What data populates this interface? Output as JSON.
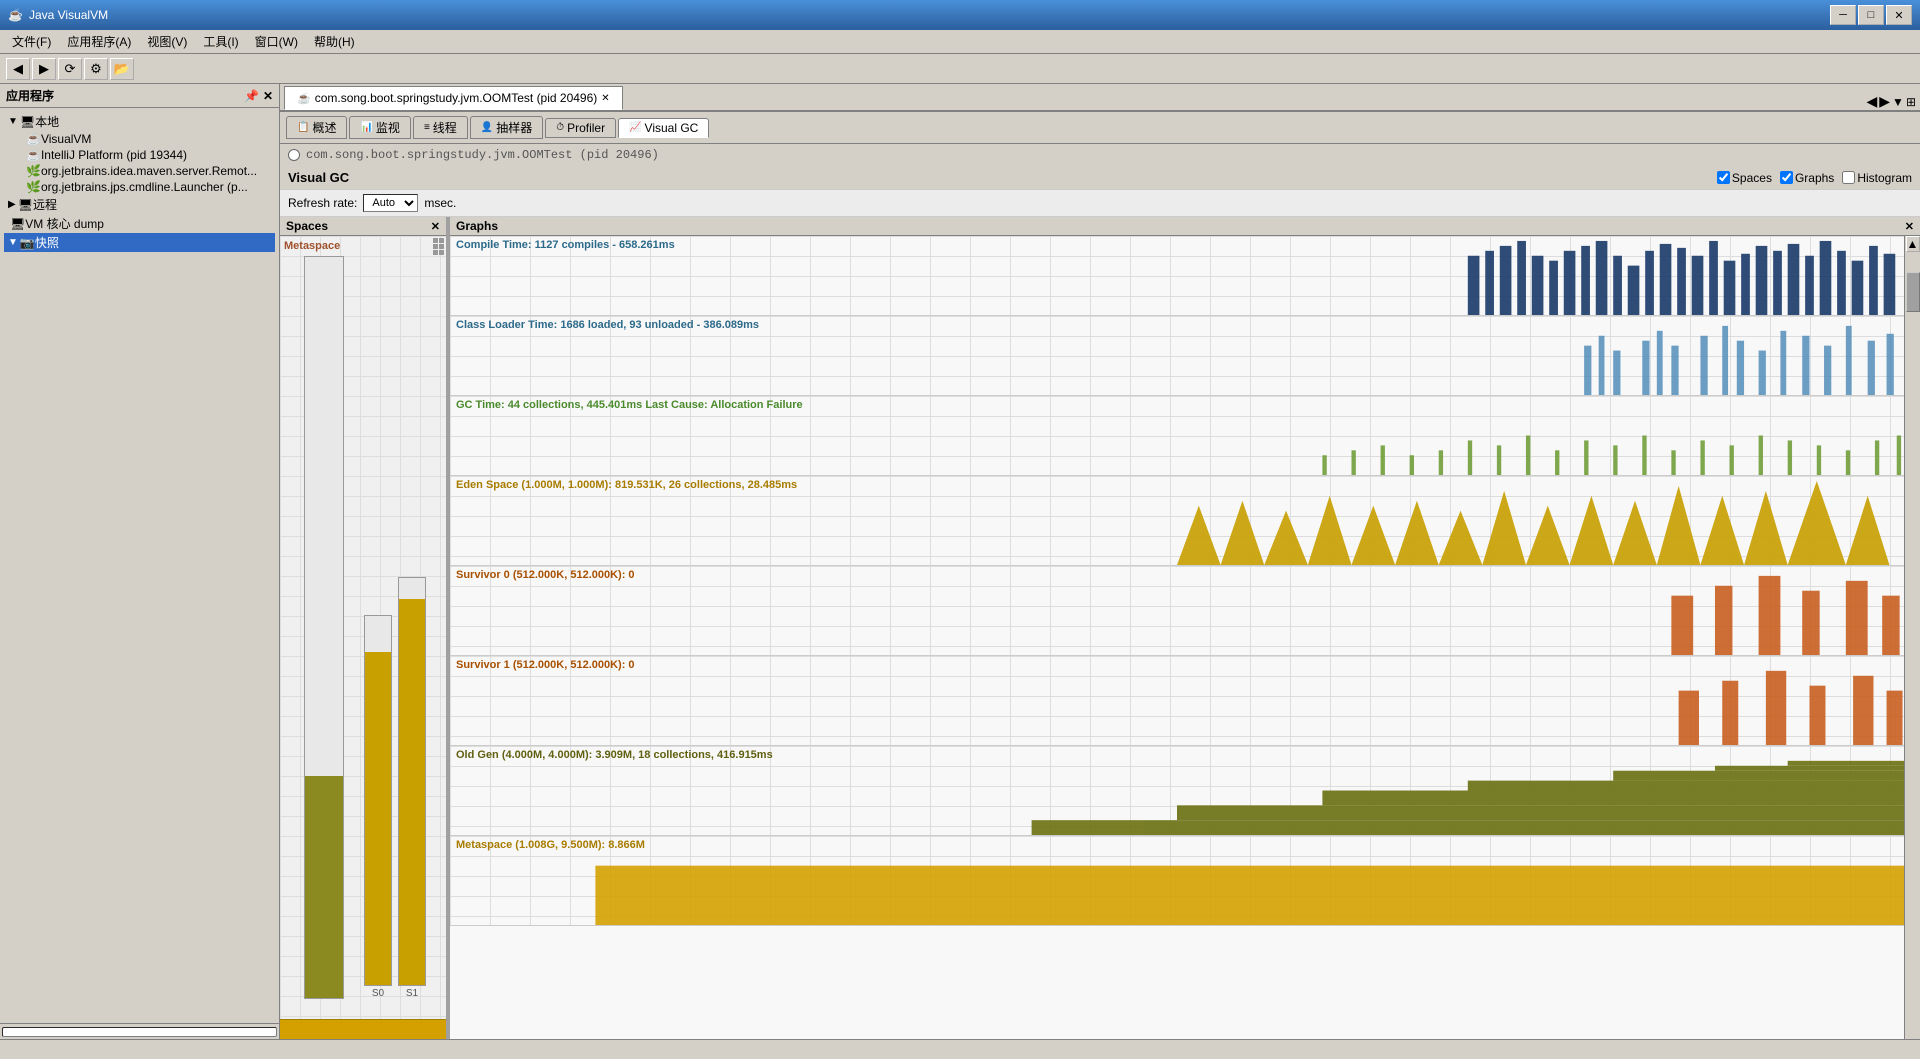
{
  "titleBar": {
    "title": "Java VisualVM",
    "icon": "☕",
    "controls": {
      "minimize": "─",
      "maximize": "□",
      "close": "✕"
    }
  },
  "menuBar": {
    "items": [
      "文件(F)",
      "应用程序(A)",
      "视图(V)",
      "工具(I)",
      "窗口(W)",
      "帮助(H)"
    ]
  },
  "toolbar": {
    "buttons": [
      "◀",
      "▶",
      "⟳",
      "⚙",
      "📂"
    ]
  },
  "sidebar": {
    "header": "应用程序",
    "closeBtn": "✕",
    "tree": [
      {
        "label": "本地",
        "level": 0,
        "icon": "🖥",
        "expanded": true
      },
      {
        "label": "VisualVM",
        "level": 1,
        "icon": "☕"
      },
      {
        "label": "IntelliJ Platform (pid 19344)",
        "level": 1,
        "icon": "☕"
      },
      {
        "label": "org.jetbrains.idea.maven.server.Remot...",
        "level": 1,
        "icon": "🌿"
      },
      {
        "label": "org.jetbrains.jps.cmdline.Launcher (p...",
        "level": 1,
        "icon": "🌿"
      },
      {
        "label": "远程",
        "level": 0,
        "icon": "🌐"
      },
      {
        "label": "VM 核心 dump",
        "level": 0,
        "icon": "📄"
      },
      {
        "label": "快照",
        "level": 0,
        "icon": "📷",
        "selected": true
      }
    ]
  },
  "mainTab": {
    "label": "com.song.boot.springstudy.jvm.OOMTest (pid 20496)",
    "closeBtn": "✕"
  },
  "innerTabs": [
    {
      "label": "概述",
      "icon": "📋",
      "active": false
    },
    {
      "label": "监视",
      "icon": "📊",
      "active": false
    },
    {
      "label": "线程",
      "icon": "≡",
      "active": false
    },
    {
      "label": "抽样器",
      "icon": "👤",
      "active": false
    },
    {
      "label": "Profiler",
      "icon": "⏱",
      "active": false
    },
    {
      "label": "Visual GC",
      "icon": "📈",
      "active": true
    }
  ],
  "processLabel": "com.song.boot.springstudy.jvm.OOMTest (pid 20496)",
  "visualGC": {
    "title": "Visual GC",
    "checkboxes": {
      "spaces": {
        "label": "Spaces",
        "checked": true
      },
      "graphs": {
        "label": "Graphs",
        "checked": true
      },
      "histogram": {
        "label": "Histogram",
        "checked": false
      }
    },
    "refreshRate": {
      "label": "Refresh rate:",
      "value": "Auto",
      "unit": "msec."
    }
  },
  "spacesPanel": {
    "title": "Spaces",
    "metaspaceLabel": "Metaspace",
    "bars": [
      {
        "id": "s0",
        "label": "S0",
        "fillPercent": 85,
        "fillColor": "#d4a000"
      },
      {
        "id": "s1",
        "label": "S1",
        "fillPercent": 92,
        "fillColor": "#d4a000"
      }
    ]
  },
  "graphsPanel": {
    "title": "Graphs",
    "rows": [
      {
        "label": "Compile Time: 1127 compiles - 658.261ms",
        "color": "#2c4a8a",
        "labelColor": "#2c6a8a"
      },
      {
        "label": "Class Loader Time: 1686 loaded, 93 unloaded - 386.089ms",
        "color": "#5a8ab0",
        "labelColor": "#2c6a8a"
      },
      {
        "label": "GC Time: 44 collections, 445.401ms Last Cause: Allocation Failure",
        "color": "#8ab040",
        "labelColor": "#4a8a2c"
      },
      {
        "label": "Eden Space (1.000M, 1.000M): 819.531K, 26 collections, 28.485ms",
        "color": "#c8a000",
        "labelColor": "#a87c00"
      },
      {
        "label": "Survivor 0 (512.000K, 512.000K): 0",
        "color": "#c86020",
        "labelColor": "#a85000"
      },
      {
        "label": "Survivor 1 (512.000K, 512.000K): 0",
        "color": "#c86020",
        "labelColor": "#a85000"
      },
      {
        "label": "Old Gen (4.000M, 4.000M): 3.909M, 18 collections, 416.915ms",
        "color": "#808020",
        "labelColor": "#606010"
      },
      {
        "label": "Metaspace (1.008G, 9.500M): 8.866M",
        "color": "#d4a000",
        "labelColor": "#a87c00"
      }
    ]
  }
}
